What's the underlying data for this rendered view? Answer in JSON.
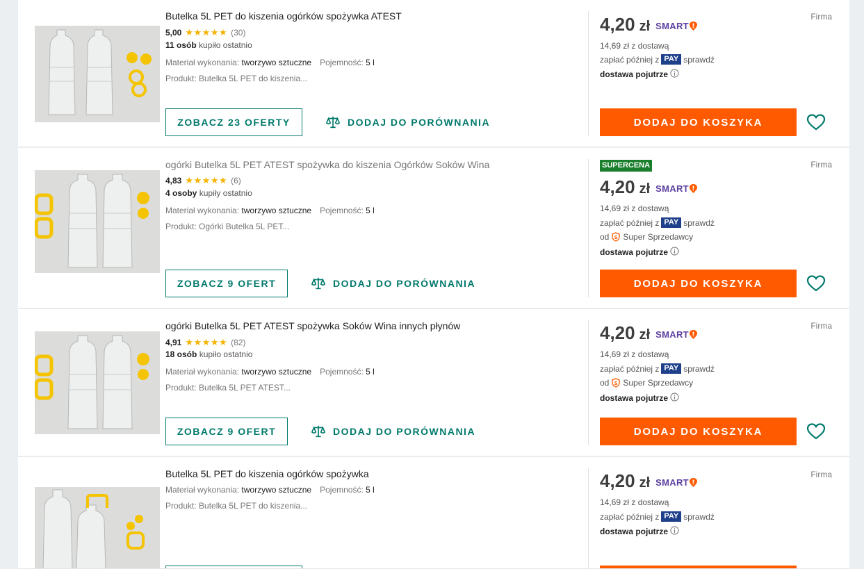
{
  "common": {
    "star_glyphs": "★★★★★",
    "firma": "Firma",
    "material_label": "Materiał wykonania:",
    "capacity_label": "Pojemność:",
    "product_label": "Produkt:",
    "currency": "zł",
    "smart_label": "SMART",
    "shipping_price": "14,69 zł z dostawą",
    "pay_prefix": "zapłać później z",
    "pay_badge": "PAY",
    "pay_suffix": "sprawdź",
    "super_prefix": "od",
    "super_label": "Super Sprzedawcy",
    "delivery": "dostawa pojutrze",
    "compare_label": "DODAJ DO PORÓWNANIA",
    "cart_label": "DODAJ DO KOSZYKA"
  },
  "listings": [
    {
      "title": "Butelka 5L PET do kiszenia ogórków spożywka ATEST",
      "title_muted": false,
      "rating": "5,00",
      "rating_count": "(30)",
      "buyers_bold": "11 osób",
      "buyers_rest": "kupiło ostatnio",
      "material": "tworzywo sztuczne",
      "capacity": "5 l",
      "product": "Butelka 5L PET do kiszenia...",
      "offers_label": "ZOBACZ 23 OFERTY",
      "badge": "",
      "price": "4,20",
      "super_seller": false
    },
    {
      "title": "ogórki Butelka 5L PET ATEST spożywka do kiszenia Ogórków Soków Wina",
      "title_muted": true,
      "rating": "4,83",
      "rating_count": "(6)",
      "buyers_bold": "4 osoby",
      "buyers_rest": "kupiły ostatnio",
      "material": "tworzywo sztuczne",
      "capacity": "5 l",
      "product": "Ogórki Butelka 5L PET...",
      "offers_label": "ZOBACZ 9 OFERT",
      "badge": "SUPERCENA",
      "price": "4,20",
      "super_seller": true
    },
    {
      "title": "ogórki Butelka 5L PET ATEST spożywka Soków Wina innych płynów",
      "title_muted": false,
      "rating": "4,91",
      "rating_count": "(82)",
      "buyers_bold": "18 osób",
      "buyers_rest": "kupiło ostatnio",
      "material": "tworzywo sztuczne",
      "capacity": "5 l",
      "product": "Butelka 5L PET ATEST...",
      "offers_label": "ZOBACZ 9 OFERT",
      "badge": "",
      "price": "4,20",
      "super_seller": true
    },
    {
      "title": "Butelka 5L PET do kiszenia ogórków spożywka",
      "title_muted": false,
      "material": "tworzywo sztuczne",
      "capacity": "5 l",
      "product": "Butelka 5L PET do kiszenia...",
      "badge": "",
      "price": "4,20",
      "super_seller": false
    }
  ]
}
